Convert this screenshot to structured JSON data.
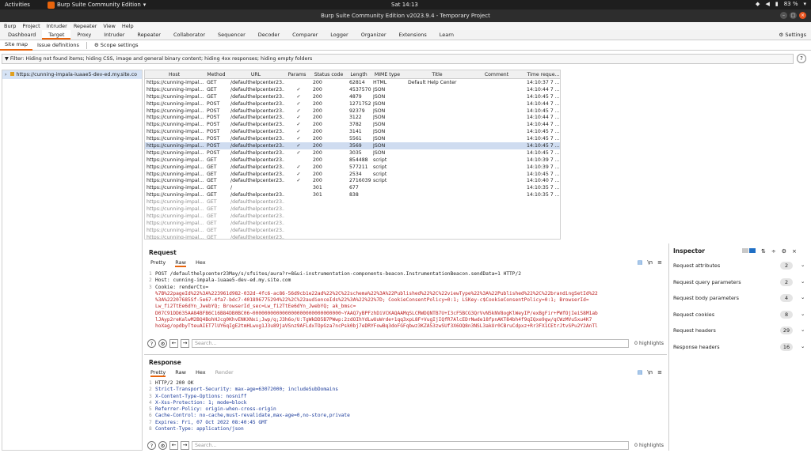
{
  "os": {
    "activities": "Activities",
    "app_name": "Burp Suite Community Edition",
    "clock": "Sat 14:13",
    "battery": "83 %"
  },
  "window": {
    "title": "Burp Suite Community Edition v2023.9.4 - Temporary Project"
  },
  "menu": [
    "Burp",
    "Project",
    "Intruder",
    "Repeater",
    "View",
    "Help"
  ],
  "tabs": [
    "Dashboard",
    "Target",
    "Proxy",
    "Intruder",
    "Repeater",
    "Collaborator",
    "Sequencer",
    "Decoder",
    "Comparer",
    "Logger",
    "Organizer",
    "Extensions",
    "Learn"
  ],
  "active_tab": "Target",
  "settings_label": "Settings",
  "subtabs": [
    "Site map",
    "Issue definitions"
  ],
  "scope_settings": "Scope settings",
  "filter_text": "Filter: Hiding not found items;  hiding CSS, image and general binary content;  hiding 4xx responses;  hiding empty folders",
  "tree": {
    "item": "https://cunning-impala-iuaae5-dev-ed.my.site.co"
  },
  "table": {
    "columns": [
      "Host",
      "Method",
      "URL",
      "Params",
      "Status code",
      "Length",
      "MIME type",
      "Title",
      "Comment",
      "Time reque..."
    ],
    "rows": [
      [
        "https://cunning-impal...",
        "GET",
        "/defaulthelpcenter23...",
        "",
        "200",
        "62814",
        "HTML",
        "Default Help Center",
        "",
        "14:10:37 7 ..."
      ],
      [
        "https://cunning-impal...",
        "GET",
        "/defaulthelpcenter23...",
        "✓",
        "200",
        "4537570",
        "JSON",
        "",
        "",
        "14:10:44 7 ..."
      ],
      [
        "https://cunning-impal...",
        "GET",
        "/defaulthelpcenter23...",
        "✓",
        "200",
        "4879",
        "JSON",
        "",
        "",
        "14:10:45 7 ..."
      ],
      [
        "https://cunning-impal...",
        "POST",
        "/defaulthelpcenter23...",
        "✓",
        "200",
        "1271752",
        "JSON",
        "",
        "",
        "14:10:44 7 ..."
      ],
      [
        "https://cunning-impal...",
        "POST",
        "/defaulthelpcenter23...",
        "✓",
        "200",
        "92379",
        "JSON",
        "",
        "",
        "14:10:45 7 ..."
      ],
      [
        "https://cunning-impal...",
        "POST",
        "/defaulthelpcenter23...",
        "✓",
        "200",
        "3122",
        "JSON",
        "",
        "",
        "14:10:44 7 ..."
      ],
      [
        "https://cunning-impal...",
        "POST",
        "/defaulthelpcenter23...",
        "✓",
        "200",
        "3782",
        "JSON",
        "",
        "",
        "14:10:44 7 ..."
      ],
      [
        "https://cunning-impal...",
        "POST",
        "/defaulthelpcenter23...",
        "✓",
        "200",
        "3141",
        "JSON",
        "",
        "",
        "14:10:45 7 ..."
      ],
      [
        "https://cunning-impal...",
        "POST",
        "/defaulthelpcenter23...",
        "✓",
        "200",
        "5561",
        "JSON",
        "",
        "",
        "14:10:45 7 ..."
      ],
      [
        "https://cunning-impal...",
        "POST",
        "/defaulthelpcenter23...",
        "✓",
        "200",
        "3569",
        "JSON",
        "",
        "",
        "14:10:45 7 ..."
      ],
      [
        "https://cunning-impal...",
        "POST",
        "/defaulthelpcenter23...",
        "✓",
        "200",
        "3035",
        "JSON",
        "",
        "",
        "14:10:45 7 ..."
      ],
      [
        "https://cunning-impal...",
        "GET",
        "/defaulthelpcenter23...",
        "",
        "200",
        "854488",
        "script",
        "",
        "",
        "14:10:39 7 ..."
      ],
      [
        "https://cunning-impal...",
        "GET",
        "/defaulthelpcenter23...",
        "✓",
        "200",
        "577211",
        "script",
        "",
        "",
        "14:10:39 7 ..."
      ],
      [
        "https://cunning-impal...",
        "GET",
        "/defaulthelpcenter23...",
        "✓",
        "200",
        "2534",
        "script",
        "",
        "",
        "14:10:45 7 ..."
      ],
      [
        "https://cunning-impal...",
        "GET",
        "/defaulthelpcenter23...",
        "✓",
        "200",
        "2716039",
        "script",
        "",
        "",
        "14:10:40 7 ..."
      ],
      [
        "https://cunning-impal...",
        "GET",
        "/",
        "",
        "301",
        "677",
        "",
        "",
        "",
        "14:10:35 7 ..."
      ],
      [
        "https://cunning-impal...",
        "GET",
        "/defaulthelpcenter23...",
        "",
        "301",
        "838",
        "",
        "",
        "",
        "14:10:35 7 ..."
      ],
      [
        "https://cunning-impal...",
        "GET",
        "/defaulthelpcenter23...",
        "",
        "",
        "",
        "",
        "",
        "",
        ""
      ],
      [
        "https://cunning-impal...",
        "GET",
        "/defaulthelpcenter23...",
        "",
        "",
        "",
        "",
        "",
        "",
        ""
      ],
      [
        "https://cunning-impal...",
        "GET",
        "/defaulthelpcenter23...",
        "",
        "",
        "",
        "",
        "",
        "",
        ""
      ],
      [
        "https://cunning-impal...",
        "GET",
        "/defaulthelpcenter23...",
        "",
        "",
        "",
        "",
        "",
        "",
        ""
      ],
      [
        "https://cunning-impal...",
        "GET",
        "/defaulthelpcenter23...",
        "",
        "",
        "",
        "",
        "",
        "",
        ""
      ],
      [
        "https://cunning-impal...",
        "GET",
        "/defaulthelpcenter23...",
        "",
        "",
        "",
        "",
        "",
        "",
        ""
      ],
      [
        "https://cunning-impal...",
        "GET",
        "/defaulthelpcenter23...",
        "",
        "",
        "",
        "",
        "",
        "",
        ""
      ]
    ],
    "selected_row": 9,
    "grey_from": 17
  },
  "request": {
    "title": "Request",
    "tabs": [
      "Pretty",
      "Raw",
      "Hex"
    ],
    "active": "Raw",
    "lines": [
      "POST /defaulthelpcenter23May/s/sfsites/aura?r=8&ui-instrumentation-components-beacon.InstrumentationBeacon.sendData=1 HTTP/2",
      "Host: cunning-impala-iuaae5-dev-ed.my.site.com",
      "Cookie: renderCtx=",
      "%7B%22pageId%22%3A%223961d982-032d-4fc6-ac86-56d9cb1e22ad%22%2C%22schema%22%3A%22Published%22%2C%22viewType%22%3A%22Published%22%2C%22brandingSetId%22",
      "%3A%22207685Sf-5e67-4fa7-bdc7-401896775294%22%2C%22audienceIds%22%3A%22%22%7D; CookieConsentPolicy=0:1; LSKey-c$CookieConsentPolicy=0:1; BrowserId=",
      "Lw_fi2TtEe6dYn_JwebYQ; BrowserId_sec=Lw_fi2TtEe6dYn_JwebYQ; ak_bmsc=",
      "D07C91DD635AA84BFB6C16B84DB0BC06~000000000000000000000000000000~YAAQ7yBPFzhDiVCKAQAAMqSLCRWDQNTB7U+I3cF5BCG3QrVvN5kNV8ogKlWeyIP/exBgFir+PWfOjIeiS8M1ab",
      "lJAyp2reKalwM2BQ4BohHJcg0KhvENKXNxi;Jwp/q;J3h6o/U:TgWkDD5B7PWwp:2zdOIhYdLwUuWrde+1qq3xpL8F+VugIjIQfR7AlcEDrNwde18fpnAKT84bh4f9qIQxe9gw/qCWzMVu5xu4K7",
      "hoXag/opdbyTteuAIET7lUY6qIgE2tmHLwxg1J3u89jaVSnz9AFLdxTOpGza7ncPsk0bj7eDRYFowBq3doFGFqbwz3KZA53zwSUf3X6OQ8n3NSL3akUr0CBruCdpxz+Rr3FX1CEtrJtvSPu2Y2AnTl"
    ],
    "search_placeholder": "Search...",
    "highlights": "0 highlights"
  },
  "response": {
    "title": "Response",
    "tabs": [
      "Pretty",
      "Raw",
      "Hex",
      "Render"
    ],
    "active": "Pretty",
    "lines": [
      "HTTP/2 200 OK",
      "Strict-Transport-Security: max-age=63072000; includeSubDomains",
      "X-Content-Type-Options: nosniff",
      "X-Xss-Protection: 1; mode=block",
      "Referrer-Policy: origin-when-cross-origin",
      "Cache-Control: no-cache,must-revalidate,max-age=0,no-store,private",
      "Expires: Fri, 07 Oct 2022 08:40:45 GMT",
      "Content-Type: application/json"
    ],
    "search_placeholder": "Search...",
    "highlights": "0 highlights"
  },
  "inspector": {
    "title": "Inspector",
    "rows": [
      {
        "name": "Request attributes",
        "count": "2"
      },
      {
        "name": "Request query parameters",
        "count": "2"
      },
      {
        "name": "Request body parameters",
        "count": "4"
      },
      {
        "name": "Request cookies",
        "count": "8"
      },
      {
        "name": "Request headers",
        "count": "29"
      },
      {
        "name": "Response headers",
        "count": "16"
      }
    ]
  },
  "colors": {
    "accent": "#e8640c",
    "selection": "#cfdcf0",
    "blue": "#1f6fc5"
  }
}
